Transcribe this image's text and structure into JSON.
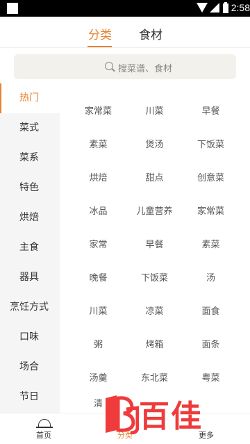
{
  "status_bar": {
    "time": "2:58"
  },
  "top_tabs": [
    {
      "label": "分类",
      "active": true
    },
    {
      "label": "食材",
      "active": false
    }
  ],
  "search": {
    "placeholder": "搜菜谱、食材"
  },
  "sidebar": {
    "items": [
      {
        "label": "热门",
        "active": true
      },
      {
        "label": "菜式"
      },
      {
        "label": "菜系"
      },
      {
        "label": "特色"
      },
      {
        "label": "烘焙"
      },
      {
        "label": "主食"
      },
      {
        "label": "器具"
      },
      {
        "label": "烹饪方式"
      },
      {
        "label": "口味"
      },
      {
        "label": "场合"
      },
      {
        "label": "节日"
      }
    ]
  },
  "grid": {
    "items": [
      "家常菜",
      "川菜",
      "早餐",
      "素菜",
      "煲汤",
      "下饭菜",
      "烘焙",
      "甜点",
      "创意菜",
      "冰品",
      "儿童营养",
      "家常菜",
      "家常",
      "早餐",
      "素菜",
      "晚餐",
      "下饭菜",
      "汤",
      "川菜",
      "凉菜",
      "面食",
      "粥",
      "烤箱",
      "面条",
      "汤羹",
      "东北菜",
      "粤菜",
      "清"
    ]
  },
  "bottom_nav": [
    {
      "label": "首页",
      "icon": "chef-hat-icon"
    },
    {
      "label": "分类",
      "active": true
    },
    {
      "label": "更多"
    }
  ],
  "watermark": {
    "text": "百佳"
  },
  "colors": {
    "accent": "#e8812f",
    "watermark": "#ef3b3b"
  }
}
